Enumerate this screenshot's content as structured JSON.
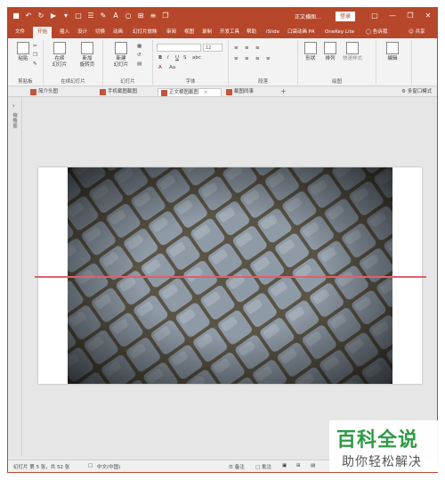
{
  "titlebar": {
    "qat_icons": [
      "save-icon",
      "undo-icon",
      "redo-icon",
      "start-from-beginning-icon",
      "more-icon"
    ],
    "doc_title": "正文横图...",
    "login_label": "登录",
    "minimize": "—",
    "restore": "❐",
    "close": "✕"
  },
  "tabs": [
    "文件",
    "开始",
    "插入",
    "设计",
    "切换",
    "动画",
    "幻灯片放映",
    "审阅",
    "视图",
    "录制",
    "开发工具",
    "帮助",
    "iSlide",
    "口袋动画 PA",
    "OneKey Lite"
  ],
  "active_tab": "开始",
  "tell_me": "告诉我",
  "share": "共享",
  "ribbon": {
    "paste_label": "粘贴",
    "clipboard_group": "剪贴板",
    "new_slide_from_outline": "在续\n幻灯片",
    "new_slide_reuse": "新加\n旋转页",
    "slides_group": "在续幻灯片",
    "new_slide": "新建\n幻灯片",
    "slides_group2": "幻灯片",
    "font_group": "字体",
    "paragraph_group": "段落",
    "shape_label": "形状",
    "arrange_label": "排列",
    "quick_styles_label": "快速样式",
    "drawing_group": "绘图",
    "editing_label": "编辑",
    "font_size": "12"
  },
  "doc_tabs": [
    {
      "label": "简介头图"
    },
    {
      "label": "手机截图截图"
    },
    {
      "label": "正文横图截图"
    },
    {
      "label": "截图同事"
    }
  ],
  "active_doc_tab": "正文横图截图",
  "mini_window": "多窗口模式",
  "left_pane": {
    "label": "缩略图"
  },
  "status": {
    "slide_info": "幻灯片 第 5 张，共 52 张",
    "language": "中文(中国)",
    "notes": "备注",
    "comments": "批注"
  },
  "watermark": {
    "big": "百科全说",
    "small": "助你轻松解决"
  },
  "colors": {
    "accent": "#b7472a",
    "divider_line": "#e0606a"
  }
}
